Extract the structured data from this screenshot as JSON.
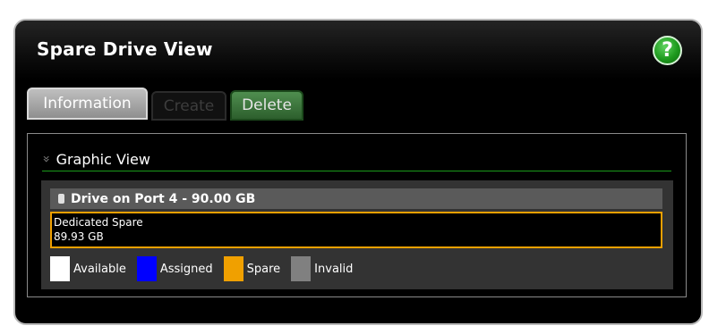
{
  "panel": {
    "title": "Spare Drive View",
    "help_label": "?"
  },
  "tabs": [
    {
      "label": "Information",
      "state": "active"
    },
    {
      "label": "Create",
      "state": "disabled"
    },
    {
      "label": "Delete",
      "state": "enabled"
    }
  ],
  "section": {
    "chevron": "»",
    "title": "Graphic View"
  },
  "drive": {
    "header": "Drive on Port 4 - 90.00 GB",
    "segment": {
      "type": "Dedicated Spare",
      "size": "89.93 GB",
      "color": "#f0a000",
      "fraction": 1.0
    }
  },
  "legend": [
    {
      "label": "Available",
      "color": "#ffffff"
    },
    {
      "label": "Assigned",
      "color": "#0000ff"
    },
    {
      "label": "Spare",
      "color": "#f0a000"
    },
    {
      "label": "Invalid",
      "color": "#808080"
    }
  ],
  "icons": {
    "help": "help-icon",
    "chevron": "double-chevron-down-icon",
    "drive": "drive-icon"
  }
}
